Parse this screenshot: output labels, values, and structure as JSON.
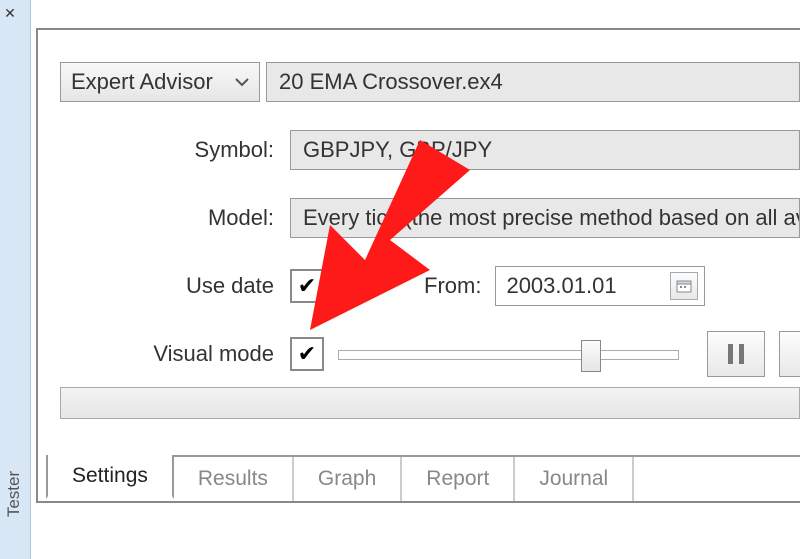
{
  "window": {
    "side_tab": "Tester"
  },
  "form": {
    "type_label": "Expert Advisor",
    "ea_file": "20 EMA Crossover.ex4",
    "symbol_label": "Symbol:",
    "symbol_value": "GBPJPY, GBP/JPY",
    "model_label": "Model:",
    "model_value": "Every tick (the most precise method based on all available",
    "use_date_label": "Use date",
    "use_date_checked": true,
    "from_label": "From:",
    "from_value": "2003.01.01",
    "visual_mode_label": "Visual mode",
    "visual_mode_checked": true,
    "slider_pos_pct": 74
  },
  "tabs": {
    "items": [
      "Settings",
      "Results",
      "Graph",
      "Report",
      "Journal"
    ],
    "active_index": 0
  }
}
